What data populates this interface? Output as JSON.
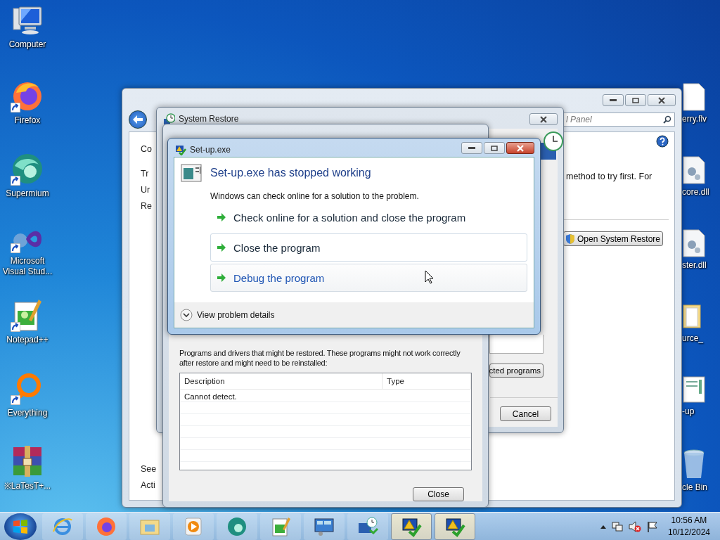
{
  "desktop_icons": [
    {
      "label": "Computer",
      "kind": "computer",
      "shortcut": false
    },
    {
      "label": "Firefox",
      "kind": "firefox",
      "shortcut": true
    },
    {
      "label": "Supermium",
      "kind": "supermium",
      "shortcut": true
    },
    {
      "label": "Microsoft Visual Stud...",
      "kind": "vs",
      "shortcut": true
    },
    {
      "label": "Notepad++",
      "kind": "notepad",
      "shortcut": true
    },
    {
      "label": "Everything",
      "kind": "everything",
      "shortcut": true
    },
    {
      "label": "※LaTesT+...",
      "kind": "archive",
      "shortcut": false
    }
  ],
  "desktop_icons_right": [
    {
      "label": "erry.flv",
      "kind": "file"
    },
    {
      "label": "core.dll",
      "kind": "dll"
    },
    {
      "label": "ster.dll",
      "kind": "dll"
    },
    {
      "label": "urce_",
      "kind": "folder"
    },
    {
      "label": "-up",
      "kind": "document"
    },
    {
      "label": "cle Bin",
      "kind": "recycle"
    }
  ],
  "control_panel": {
    "search_placeholder": "l Panel",
    "left_fragments": [
      "Co",
      "Tr",
      "Ur",
      "Re"
    ],
    "bottom_fragments": [
      "See",
      "Acti"
    ],
    "text": "method to try first. For",
    "button": "Open System Restore"
  },
  "system_restore": {
    "title": "System Restore",
    "buttons": [
      "cted programs",
      "Cancel"
    ]
  },
  "restore_details": {
    "text": "Programs and drivers that might be restored. These programs might not work correctly after restore and might need to be reinstalled:",
    "table": {
      "columns": [
        "Description",
        "Type"
      ],
      "rows": [
        [
          "Cannot detect."
        ]
      ]
    },
    "button": "Close"
  },
  "error_dialog": {
    "title": "Set-up.exe",
    "heading": "Set-up.exe has stopped working",
    "message": "Windows can check online for a solution to the problem.",
    "options": [
      {
        "label": "Check online for a solution and close the program",
        "kind": "plain"
      },
      {
        "label": "Close the program",
        "kind": "boxed"
      },
      {
        "label": "Debug the program",
        "kind": "hover"
      }
    ],
    "details_toggle": {
      "label": "View problem details",
      "expanded": false
    }
  },
  "taskbar": {
    "items": [
      {
        "kind": "ie",
        "active": false
      },
      {
        "kind": "firefox",
        "active": false
      },
      {
        "kind": "explorer",
        "active": false
      },
      {
        "kind": "media",
        "active": false
      },
      {
        "kind": "supermium",
        "active": false
      },
      {
        "kind": "notepad",
        "active": false
      },
      {
        "kind": "cpanel",
        "active": false
      },
      {
        "kind": "restore",
        "active": false
      },
      {
        "kind": "warn",
        "active": true
      },
      {
        "kind": "warn",
        "active": true
      }
    ],
    "clock": {
      "time": "10:56 AM",
      "date": "10/12/2024"
    }
  }
}
